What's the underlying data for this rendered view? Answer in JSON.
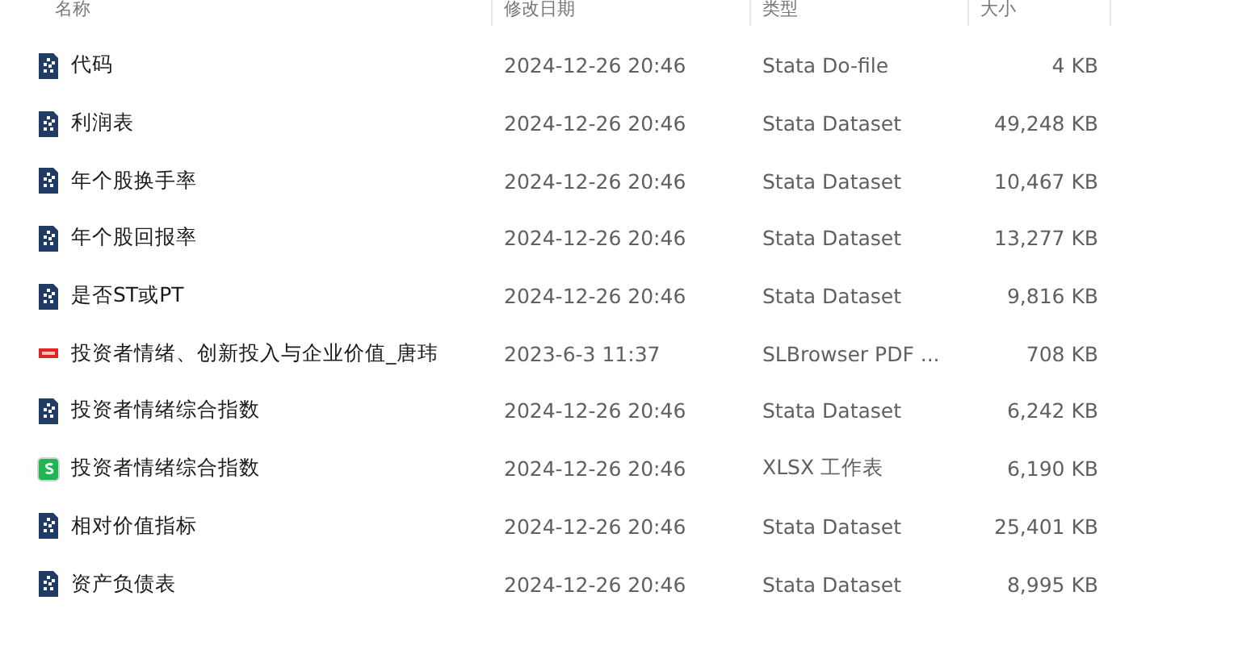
{
  "columns": [
    "名称",
    "修改日期",
    "类型",
    "大小"
  ],
  "files": [
    {
      "name": "代码",
      "modified": "2024-12-26 20:46",
      "type": "Stata Do-file",
      "size": "4 KB",
      "kind": "stata"
    },
    {
      "name": "利润表",
      "modified": "2024-12-26 20:46",
      "type": "Stata Dataset",
      "size": "49,248 KB",
      "kind": "stata"
    },
    {
      "name": "年个股换手率",
      "modified": "2024-12-26 20:46",
      "type": "Stata Dataset",
      "size": "10,467 KB",
      "kind": "stata"
    },
    {
      "name": "年个股回报率",
      "modified": "2024-12-26 20:46",
      "type": "Stata Dataset",
      "size": "13,277 KB",
      "kind": "stata"
    },
    {
      "name": "是否ST或PT",
      "modified": "2024-12-26 20:46",
      "type": "Stata Dataset",
      "size": "9,816 KB",
      "kind": "stata"
    },
    {
      "name": "投资者情绪、创新投入与企业价值_唐玮",
      "modified": "2023-6-3 11:37",
      "type": "SLBrowser PDF ...",
      "size": "708 KB",
      "kind": "pdf"
    },
    {
      "name": "投资者情绪综合指数",
      "modified": "2024-12-26 20:46",
      "type": "Stata Dataset",
      "size": "6,242 KB",
      "kind": "stata"
    },
    {
      "name": "投资者情绪综合指数",
      "modified": "2024-12-26 20:46",
      "type": "XLSX 工作表",
      "size": "6,190 KB",
      "kind": "sheet"
    },
    {
      "name": "相对价值指标",
      "modified": "2024-12-26 20:46",
      "type": "Stata Dataset",
      "size": "25,401 KB",
      "kind": "stata"
    },
    {
      "name": "资产负债表",
      "modified": "2024-12-26 20:46",
      "type": "Stata Dataset",
      "size": "8,995 KB",
      "kind": "stata"
    }
  ]
}
